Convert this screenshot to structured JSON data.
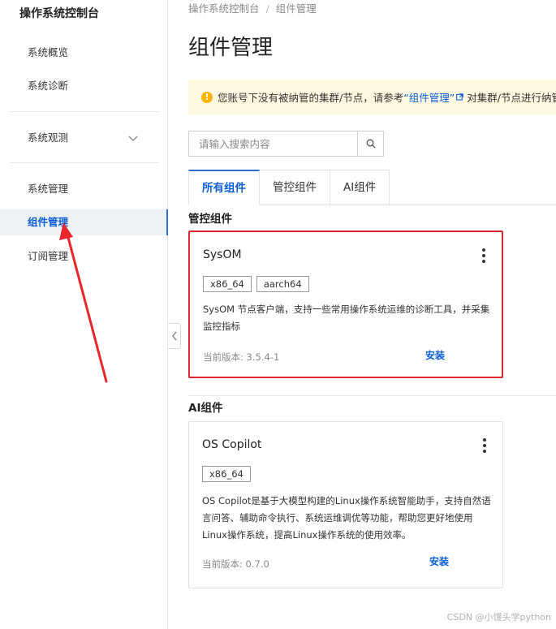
{
  "sidebar": {
    "title": "操作系统控制台",
    "items": [
      {
        "label": "系统概览"
      },
      {
        "label": "系统诊断"
      },
      {
        "label": "系统观测"
      },
      {
        "label": "系统管理"
      },
      {
        "label": "组件管理"
      },
      {
        "label": "订阅管理"
      }
    ],
    "active_item": "组件管理"
  },
  "breadcrumb": {
    "items": [
      "操作系统控制台",
      "组件管理"
    ]
  },
  "page": {
    "title": "组件管理"
  },
  "notice": {
    "text_before": "您账号下没有被纳管的集群/节点，请参考",
    "link_text": "“组件管理”",
    "text_after": "对集群/节点进行纳管"
  },
  "search": {
    "placeholder": "请输入搜索内容",
    "value": ""
  },
  "tabs": [
    {
      "label": "所有组件"
    },
    {
      "label": "管控组件"
    },
    {
      "label": "AI组件"
    }
  ],
  "sections": [
    {
      "title": "管控组件",
      "cards": [
        {
          "name": "SysOM",
          "tags": [
            "x86_64",
            "aarch64"
          ],
          "description": "SysOM 节点客户端，支持一些常用操作系统运维的诊断工具，并采集监控指标",
          "version": "当前版本: 3.5.4-1",
          "action": "安装"
        }
      ]
    },
    {
      "title": "AI组件",
      "cards": [
        {
          "name": "OS Copilot",
          "tags": [
            "x86_64"
          ],
          "description": "OS Copilot是基于大模型构建的Linux操作系统智能助手，支持自然语言问答、辅助命令执行、系统运维调优等功能，帮助您更好地使用Linux操作系统，提高Linux操作系统的使用效率。",
          "version": "当前版本: 0.7.0",
          "action": "安装"
        }
      ]
    }
  ],
  "watermark": "CSDN @小馒头学python",
  "colors": {
    "accent": "#0b5ed7",
    "highlight_border": "#d9262b",
    "notice_bg": "#fff8e1",
    "warning_icon": "#f7b500"
  }
}
